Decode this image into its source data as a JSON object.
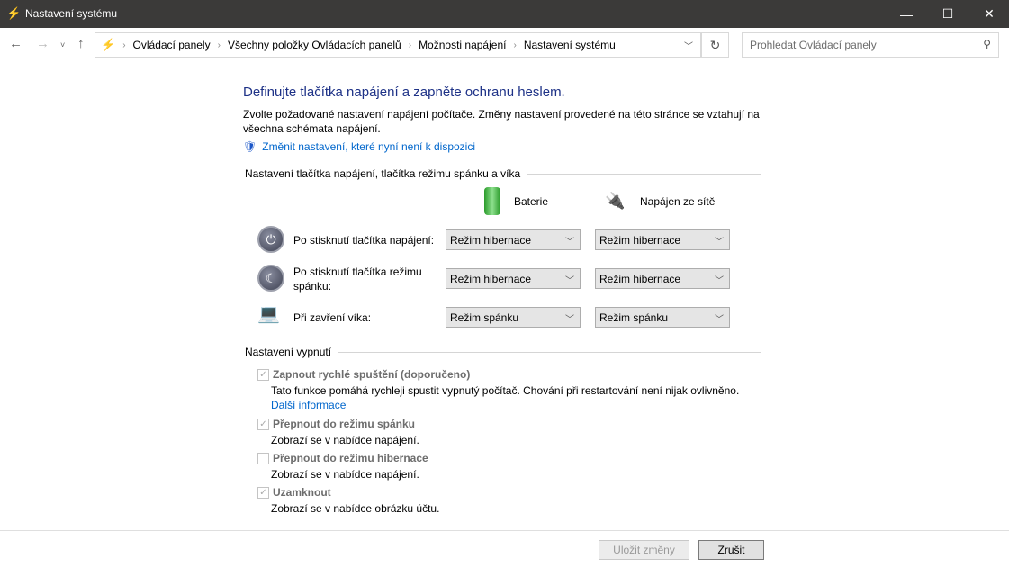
{
  "window": {
    "title": "Nastavení systému"
  },
  "breadcrumb": [
    "Ovládací panely",
    "Všechny položky Ovládacích panelů",
    "Možnosti napájení",
    "Nastavení systému"
  ],
  "search": {
    "placeholder": "Prohledat Ovládací panely"
  },
  "main": {
    "heading": "Definujte tlačítka napájení a zapněte ochranu heslem.",
    "intro": "Zvolte požadované nastavení napájení počítače. Změny nastavení provedené na této stránce se vztahují na všechna schémata napájení.",
    "change_link": "Změnit nastavení, které nyní není k dispozici",
    "buttons_group": "Nastavení tlačítka napájení, tlačítka režimu spánku a víka",
    "col_battery": "Baterie",
    "col_ac": "Napájen ze sítě",
    "rows": [
      {
        "label": "Po stisknutí tlačítka napájení:",
        "battery": "Režim hibernace",
        "ac": "Režim hibernace"
      },
      {
        "label": "Po stisknutí tlačítka režimu spánku:",
        "battery": "Režim hibernace",
        "ac": "Režim hibernace"
      },
      {
        "label": "Při zavření víka:",
        "battery": "Režim spánku",
        "ac": "Režim spánku"
      }
    ],
    "shutdown_group": "Nastavení vypnutí",
    "options": [
      {
        "label": "Zapnout rychlé spuštění (doporučeno)",
        "desc": "Tato funkce pomáhá rychleji spustit vypnutý počítač. Chování při restartování není nijak ovlivněno.",
        "link": "Další informace",
        "checked": true
      },
      {
        "label": "Přepnout do režimu spánku",
        "desc": "Zobrazí se v nabídce napájení.",
        "checked": true
      },
      {
        "label": "Přepnout do režimu hibernace",
        "desc": "Zobrazí se v nabídce napájení.",
        "checked": false
      },
      {
        "label": "Uzamknout",
        "desc": "Zobrazí se v nabídce obrázku účtu.",
        "checked": true
      }
    ]
  },
  "footer": {
    "save": "Uložit změny",
    "cancel": "Zrušit"
  }
}
